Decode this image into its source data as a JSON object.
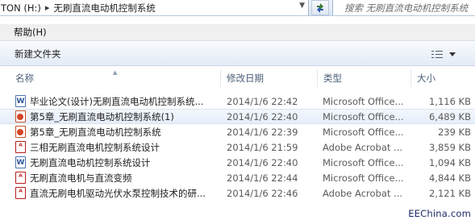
{
  "address_bar": {
    "drive": "TON (H:)",
    "folder": "无刷直流电动机控制系统"
  },
  "search": {
    "placeholder": "搜索 无刷直流电动机控制系统"
  },
  "menu": {
    "items": [
      {
        "label": "帮助(H)"
      }
    ]
  },
  "toolbar": {
    "new_folder_label": "新建文件夹",
    "view_icon": "details-view-icon"
  },
  "columns": {
    "name": "名称",
    "date": "修改日期",
    "type": "类型",
    "size": "大小"
  },
  "files": [
    {
      "icon": "word",
      "name": "毕业论文(设计)无刷直流电动机控制系统...",
      "date": "2014/1/6 22:42",
      "type": "Microsoft Office...",
      "size": "1,116 KB"
    },
    {
      "icon": "ppt",
      "name": "第5章_无刷直流电动机控制系统(1)",
      "date": "2014/1/6 22:40",
      "type": "Microsoft Office...",
      "size": "6,489 KB",
      "selected": true
    },
    {
      "icon": "ppt",
      "name": "第5章_无刷直流电动机控制系统",
      "date": "2014/1/6 22:39",
      "type": "Microsoft Office...",
      "size": "239 KB"
    },
    {
      "icon": "pdf",
      "name": "三相无刷直流电机控制系统设计",
      "date": "2014/1/6 21:59",
      "type": "Adobe Acrobat ...",
      "size": "3,859 KB"
    },
    {
      "icon": "word",
      "name": "无刷直流电动机控制系统设计",
      "date": "2014/1/6 22:40",
      "type": "Microsoft Office...",
      "size": "1,094 KB"
    },
    {
      "icon": "pdf",
      "name": "无刷直流电机与直流变频",
      "date": "2014/1/6 22:44",
      "type": "Microsoft Office...",
      "size": "4,844 KB"
    },
    {
      "icon": "pdf",
      "name": "直流无刷电机驱动光伏水泵控制技术的研...",
      "date": "2014/1/6 22:46",
      "type": "Adobe Acrobat ...",
      "size": "2,121 KB"
    }
  ],
  "watermark": "EEChina.com"
}
